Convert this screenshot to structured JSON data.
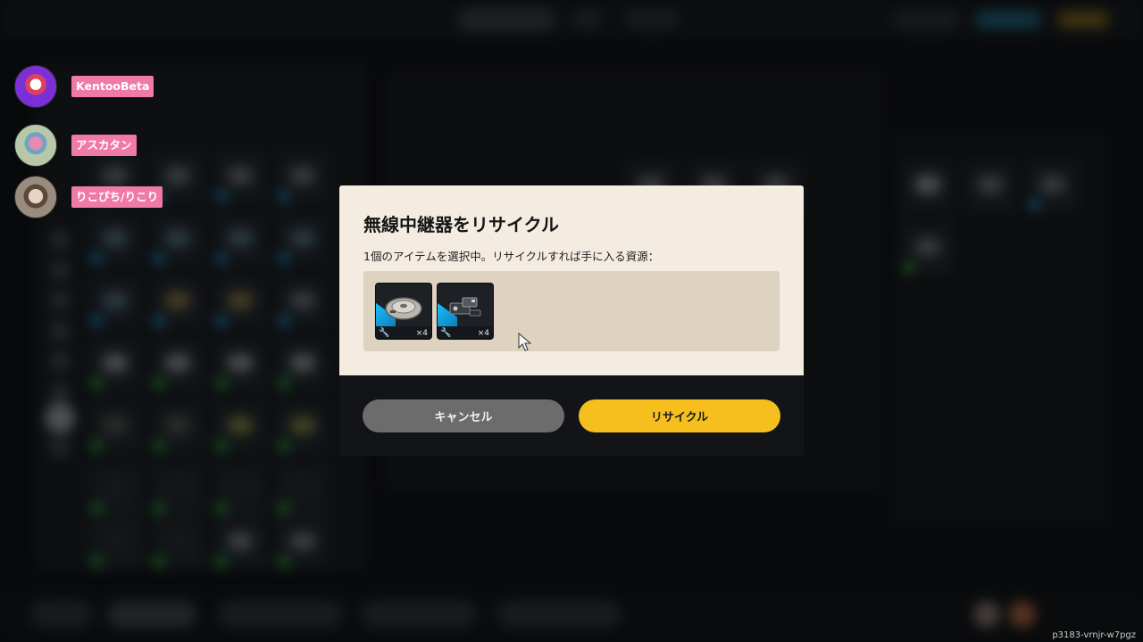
{
  "viewers": [
    {
      "name": "KentooBeta",
      "avatar_color": "#7b2fd6"
    },
    {
      "name": "アスカタン",
      "avatar_color": "#b7c8a8"
    },
    {
      "name": "りこぴち/りこり",
      "avatar_color": "#9a8c7c"
    }
  ],
  "modal": {
    "title": "無線中継器をリサイクル",
    "subtitle": "1個のアイテムを選択中。リサイクルすれば手に入る資源：",
    "rewards": [
      {
        "icon": "disc-component-icon",
        "quantity": "×4",
        "rarity_color": "#18c0ff"
      },
      {
        "icon": "electronic-parts-icon",
        "quantity": "×4",
        "rarity_color": "#18c0ff"
      }
    ],
    "cancel_label": "キャンセル",
    "recycle_label": "リサイクル"
  },
  "colors": {
    "modal_bg": "#f4ece1",
    "modal_footer_bg": "#121418",
    "accent_yellow": "#f6bf1d",
    "cancel_gray": "#6c6c6c",
    "viewer_tag_pink": "#f07aa7"
  },
  "watermark": "p3183-vrnjr-w7pgz"
}
